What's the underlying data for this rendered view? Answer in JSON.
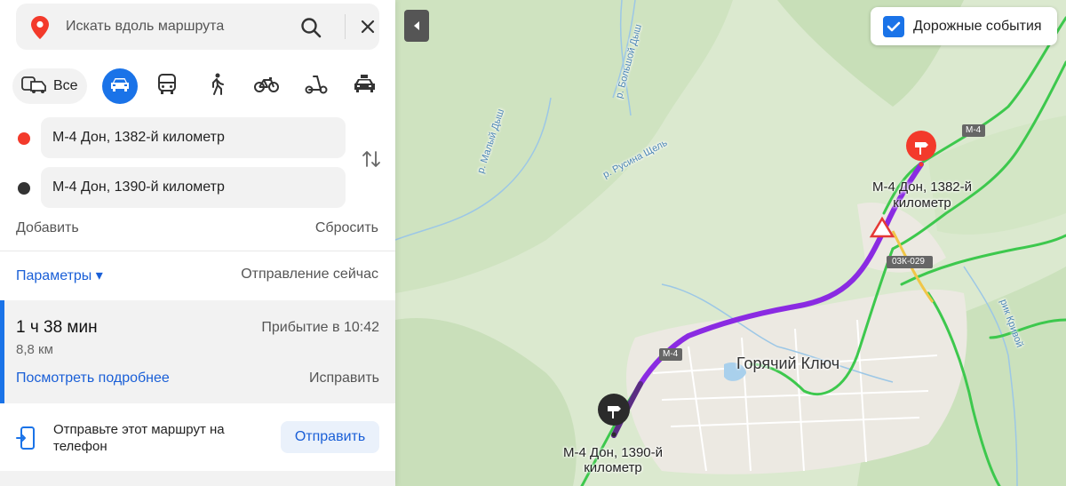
{
  "search": {
    "placeholder": "Искать вдоль маршрута"
  },
  "modes": {
    "all_label": "Все"
  },
  "waypoints": {
    "from": "М-4 Дон, 1382-й километр",
    "to": "М-4 Дон, 1390-й километр"
  },
  "actions": {
    "add": "Добавить",
    "reset": "Сбросить"
  },
  "options": {
    "params": "Параметры ▾",
    "departure": "Отправление сейчас"
  },
  "route": {
    "duration": "1 ч 38 мин",
    "distance": "8,8 км",
    "arrival": "Прибытие в 10:42",
    "details": "Посмотреть подробнее",
    "fix": "Исправить"
  },
  "send": {
    "text": "Отправьте этот маршрут на телефон",
    "button": "Отправить"
  },
  "map": {
    "traffic_toggle": "Дорожные события",
    "town": "Горячий Ключ",
    "start_label_1": "М-4 Дон, 1382-й",
    "start_label_2": "километр",
    "end_label_1": "М-4 Дон, 1390-й",
    "end_label_2": "километр",
    "road_m4_a": "М-4",
    "road_m4_b": "М-4",
    "road_03k": "03К-029",
    "rivers": [
      "р. Малый Дыш",
      "р. Большой Дыш",
      "р. Русина Щель",
      "рик Кривой"
    ]
  },
  "colors": {
    "accent": "#1a73e8",
    "route": "#8a2be2",
    "start_marker": "#f33a2b",
    "roads": "#3dc84d"
  }
}
